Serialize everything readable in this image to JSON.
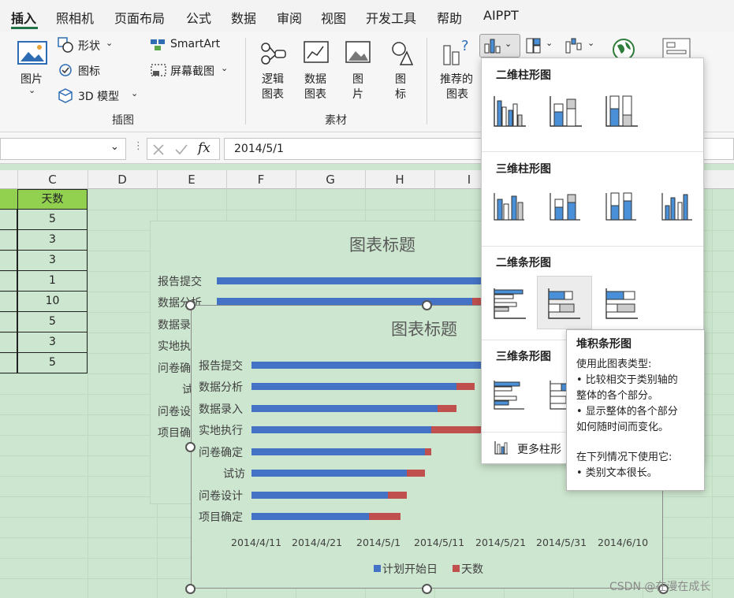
{
  "tabs": [
    "插入",
    "照相机",
    "页面布局",
    "公式",
    "数据",
    "审阅",
    "视图",
    "开发工具",
    "帮助",
    "AIPPT"
  ],
  "ribbon": {
    "illustrations": {
      "picture_label": "图片",
      "shapes_label": "形状",
      "icons_label": "图标",
      "model3d_label": "3D 模型",
      "smartart_label": "SmartArt",
      "screenshot_label": "屏幕截图",
      "group_label": "插图"
    },
    "materials": {
      "logic_label_1": "逻辑",
      "logic_label_2": "图表",
      "data_label_1": "数据",
      "data_label_2": "图表",
      "pic_label_1": "图",
      "pic_label_2": "片",
      "icon_label_1": "图",
      "icon_label_2": "标",
      "group_label": "素材"
    },
    "charts": {
      "recommended_1": "推荐的",
      "recommended_2": "图表"
    }
  },
  "formula_bar": {
    "fx": "fx",
    "value": "2014/5/1"
  },
  "columns": [
    "C",
    "D",
    "E",
    "F",
    "G",
    "H",
    "I"
  ],
  "column_c": {
    "header": "天数",
    "values": [
      "5",
      "3",
      "3",
      "1",
      "10",
      "5",
      "3",
      "5"
    ]
  },
  "chart_back": {
    "title": "图表标题",
    "categories": [
      "报告提交",
      "数据分析",
      "数据录",
      "实地执",
      "问卷确",
      "试",
      "问卷设",
      "项目确"
    ]
  },
  "chart_data": {
    "type": "bar",
    "stacked": true,
    "orientation": "horizontal",
    "title": "图表标题",
    "categories": [
      "报告提交",
      "数据分析",
      "数据录入",
      "实地执行",
      "问卷确定",
      "试访",
      "问卷设计",
      "项目确定"
    ],
    "x_ticks": [
      "2014/4/11",
      "2014/4/21",
      "2014/5/1",
      "2014/5/11",
      "2014/5/21",
      "2014/5/31",
      "2014/6/10"
    ],
    "xlim": [
      "2014/4/11",
      "2014/6/10"
    ],
    "series": [
      {
        "name": "计划开始日",
        "color": "#4472c4",
        "values": [
          "2014/5/24",
          "2014/5/14",
          "2014/5/11",
          "2014/5/10",
          "2014/5/9",
          "2014/5/6",
          "2014/5/3",
          "2014/4/30"
        ]
      },
      {
        "name": "天数",
        "color": "#c0504d",
        "values": [
          5,
          3,
          3,
          10,
          1,
          3,
          3,
          5
        ]
      }
    ],
    "legend": "bottom"
  },
  "dropdown": {
    "sec_2d_column": "二维柱形图",
    "sec_3d_column": "三维柱形图",
    "sec_2d_bar": "二维条形图",
    "sec_3d_bar": "三维条形图",
    "more_charts": "更多柱形"
  },
  "tooltip": {
    "title": "堆积条形图",
    "line1": "使用此图表类型:",
    "line2": "• 比较相交于类别轴的",
    "line3": "整体的各个部分。",
    "line4": "• 显示整体的各个部分",
    "line5": "如何随时间而变化。",
    "line6": "在下列情况下使用它:",
    "line7": "• 类别文本很长。"
  },
  "watermark": "CSDN @在漫在成长",
  "colors": {
    "accent": "#217346",
    "series1": "#4472c4",
    "series2": "#c0504d",
    "header_fill": "#92d050",
    "sheet_bg": "#cde6cf"
  }
}
